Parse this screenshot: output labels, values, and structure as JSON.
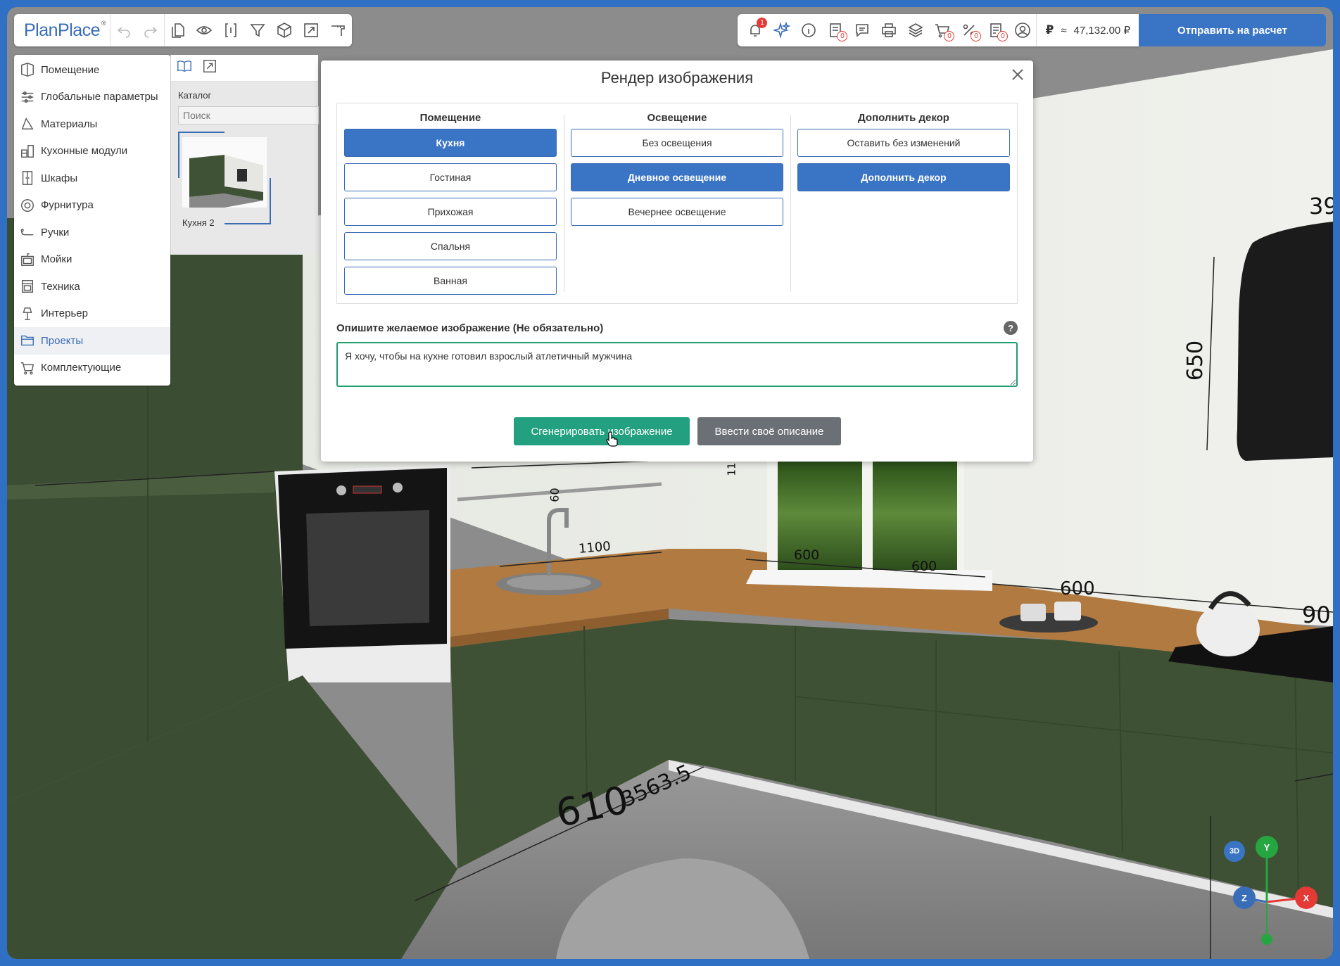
{
  "app": {
    "logo": "PlanPlace",
    "logo_mark": "®"
  },
  "toolbar_left": {
    "icons": [
      "undo-icon",
      "redo-icon",
      "files-icon",
      "eye-icon",
      "walls-icon",
      "filter-icon",
      "cube-icon",
      "fullscreen-icon",
      "ruler-icon"
    ]
  },
  "toolbar_right": {
    "notifications_count": "1",
    "icons": [
      "bell-icon",
      "ai-sparkle-icon",
      "info-icon",
      "list-icon",
      "chat-icon",
      "print-icon",
      "layers-icon",
      "cart-icon",
      "discount-icon",
      "order-icon",
      "user-icon"
    ],
    "list_count": "0",
    "cart_count": "0",
    "discount_count": "0",
    "order_count": "0",
    "currency_symbol": "₽",
    "approx": "≈",
    "price": "47,132.00 ₽",
    "send_label": "Отправить на расчет"
  },
  "sidebar": {
    "items": [
      {
        "label": "Помещение",
        "icon": "room-icon"
      },
      {
        "label": "Глобальные параметры",
        "icon": "sliders-icon"
      },
      {
        "label": "Материалы",
        "icon": "materials-icon"
      },
      {
        "label": "Кухонные модули",
        "icon": "kitchen-modules-icon"
      },
      {
        "label": "Шкафы",
        "icon": "wardrobe-icon"
      },
      {
        "label": "Фурнитура",
        "icon": "hardware-icon"
      },
      {
        "label": "Ручки",
        "icon": "handle-icon"
      },
      {
        "label": "Мойки",
        "icon": "sink-icon"
      },
      {
        "label": "Техника",
        "icon": "appliance-icon"
      },
      {
        "label": "Интерьер",
        "icon": "interior-icon"
      },
      {
        "label": "Проекты",
        "icon": "folder-icon",
        "active": true
      },
      {
        "label": "Комплектующие",
        "icon": "cart-icon"
      }
    ]
  },
  "catalog": {
    "title": "Каталог",
    "search_placeholder": "Поиск",
    "items": [
      {
        "name": "Кухня 2"
      }
    ]
  },
  "modal": {
    "title": "Рендер изображения",
    "columns": [
      {
        "header": "Помещение",
        "options": [
          "Кухня",
          "Гостиная",
          "Прихожая",
          "Спальня",
          "Ванная"
        ],
        "selected": "Кухня"
      },
      {
        "header": "Освещение",
        "options": [
          "Без освещения",
          "Дневное освещение",
          "Вечернее освещение"
        ],
        "selected": "Дневное освещение"
      },
      {
        "header": "Дополнить декор",
        "options": [
          "Оставить без изменений",
          "Дополнить декор"
        ],
        "selected": "Дополнить декор"
      }
    ],
    "description_label": "Опишите желаемое изображение (Не обязательно)",
    "help": "?",
    "description_value": "Я хочу, чтобы на кухне готовил взрослый атлетичный мужчина",
    "generate_label": "Сгенерировать изображение",
    "own_description_label": "Ввести своё описание"
  },
  "scene": {
    "dimensions": [
      "600",
      "600",
      "60",
      "1100",
      "600",
      "600",
      "600",
      "650",
      "39",
      "90",
      "610",
      "3563.5",
      "11"
    ]
  },
  "gizmo": {
    "view_3d": "3D",
    "axis_y": "Y",
    "axis_z": "Z",
    "axis_x": "X"
  },
  "colors": {
    "primary": "#3a74c4",
    "green_button": "#23a07f",
    "gray_button": "#6b7076",
    "cabinet_green": "#3e5134"
  }
}
